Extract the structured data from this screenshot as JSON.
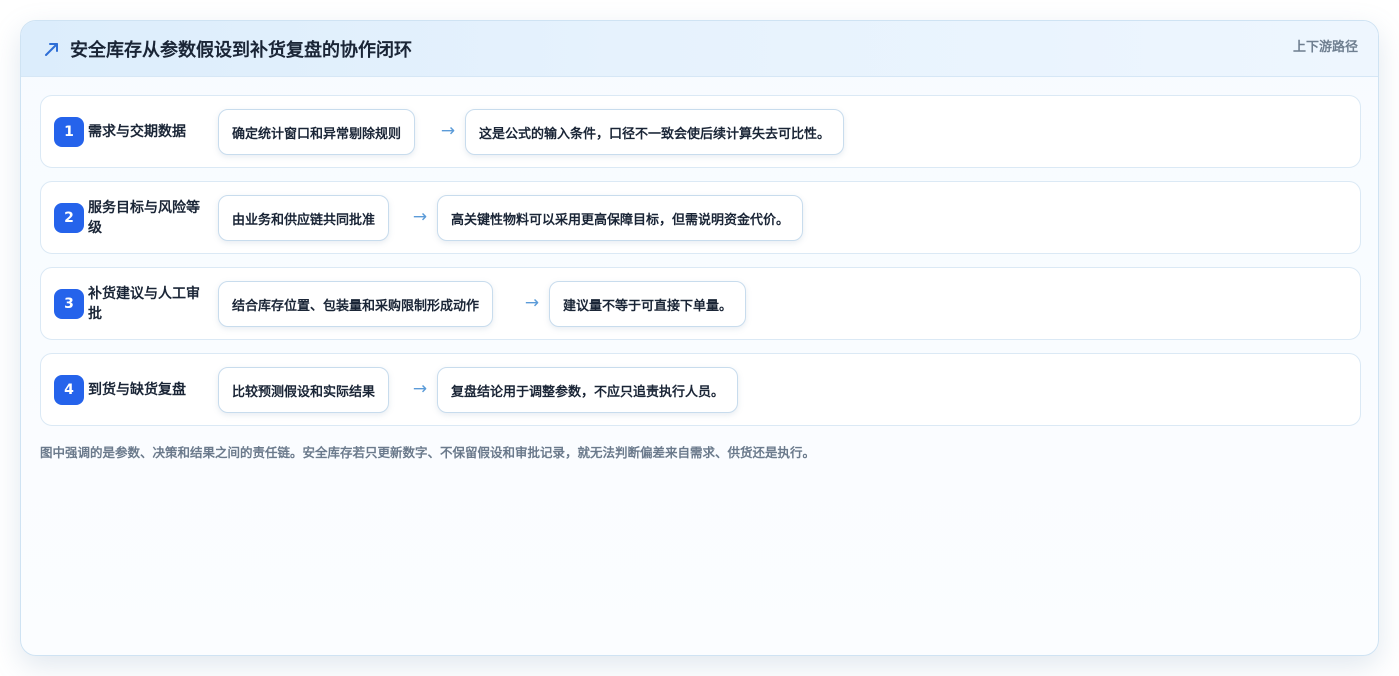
{
  "header": {
    "icon": "trend-arrow-icon",
    "title": "安全库存从参数假设到补货复盘的协作闭环",
    "tag": "上下游路径"
  },
  "steps": [
    {
      "number": "1",
      "stage": "需求与交期数据",
      "action": "确定统计窗口和异常剔除规则",
      "arrow": "→",
      "note": "这是公式的输入条件，口径不一致会使后续计算失去可比性。"
    },
    {
      "number": "2",
      "stage": "服务目标与风险等级",
      "action": "由业务和供应链共同批准",
      "arrow": "→",
      "note": "高关键性物料可以采用更高保障目标，但需说明资金代价。"
    },
    {
      "number": "3",
      "stage": "补货建议与人工审批",
      "action": "结合库存位置、包装量和采购限制形成动作",
      "arrow": "→",
      "note": "建议量不等于可直接下单量。"
    },
    {
      "number": "4",
      "stage": "到货与缺货复盘",
      "action": "比较预测假设和实际结果",
      "arrow": "→",
      "note": "复盘结论用于调整参数，不应只追责执行人员。"
    }
  ],
  "footnote": "图中强调的是参数、决策和结果之间的责任链。安全库存若只更新数字、不保留假设和审批记录，就无法判断偏差来自需求、供货还是执行。",
  "colors": {
    "accent": "#2563eb",
    "arrow": "#5b9bd8",
    "header_bg": "#dcedfc",
    "text": "#1a2536",
    "muted": "#6b7a8c"
  }
}
